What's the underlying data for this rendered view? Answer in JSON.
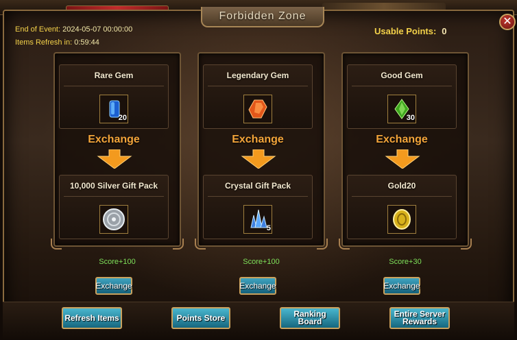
{
  "window": {
    "title": "Forbidden Zone"
  },
  "event": {
    "end_label": "End of Event:",
    "end_value": "2024-05-07 00:00:00",
    "refresh_label": "Items Refresh in:",
    "refresh_value": "0:59:44"
  },
  "points": {
    "label": "Usable Points:",
    "value": "0"
  },
  "exchanges": [
    {
      "cost_name": "Rare Gem",
      "cost_qty": "20",
      "cost_icon": "blue-gem-icon",
      "exchange_label": "Exchange",
      "reward_name": "10,000 Silver Gift Pack",
      "reward_qty": "",
      "reward_icon": "silver-coin-icon",
      "score": "Score+100",
      "button_label": "Exchange"
    },
    {
      "cost_name": "Legendary Gem",
      "cost_qty": "",
      "cost_icon": "orange-gem-icon",
      "exchange_label": "Exchange",
      "reward_name": "Crystal Gift Pack",
      "reward_qty": "5",
      "reward_icon": "crystal-icon",
      "score": "Score+100",
      "button_label": "Exchange"
    },
    {
      "cost_name": "Good Gem",
      "cost_qty": "30",
      "cost_icon": "green-gem-icon",
      "exchange_label": "Exchange",
      "reward_name": "Gold20",
      "reward_qty": "",
      "reward_icon": "gold-coin-icon",
      "score": "Score+30",
      "button_label": "Exchange"
    }
  ],
  "buttons": {
    "refresh": "Refresh Items",
    "store": "Points Store",
    "ranking": "Ranking Board",
    "server_rewards_line1": "Entire Server",
    "server_rewards_line2": "Rewards"
  },
  "colors": {
    "gold_text": "#f4d24a",
    "exchange_orange": "#f4a53a",
    "score_green": "#7ee05a",
    "button_teal": "#16677f",
    "frame_gold": "#c9a25f"
  }
}
